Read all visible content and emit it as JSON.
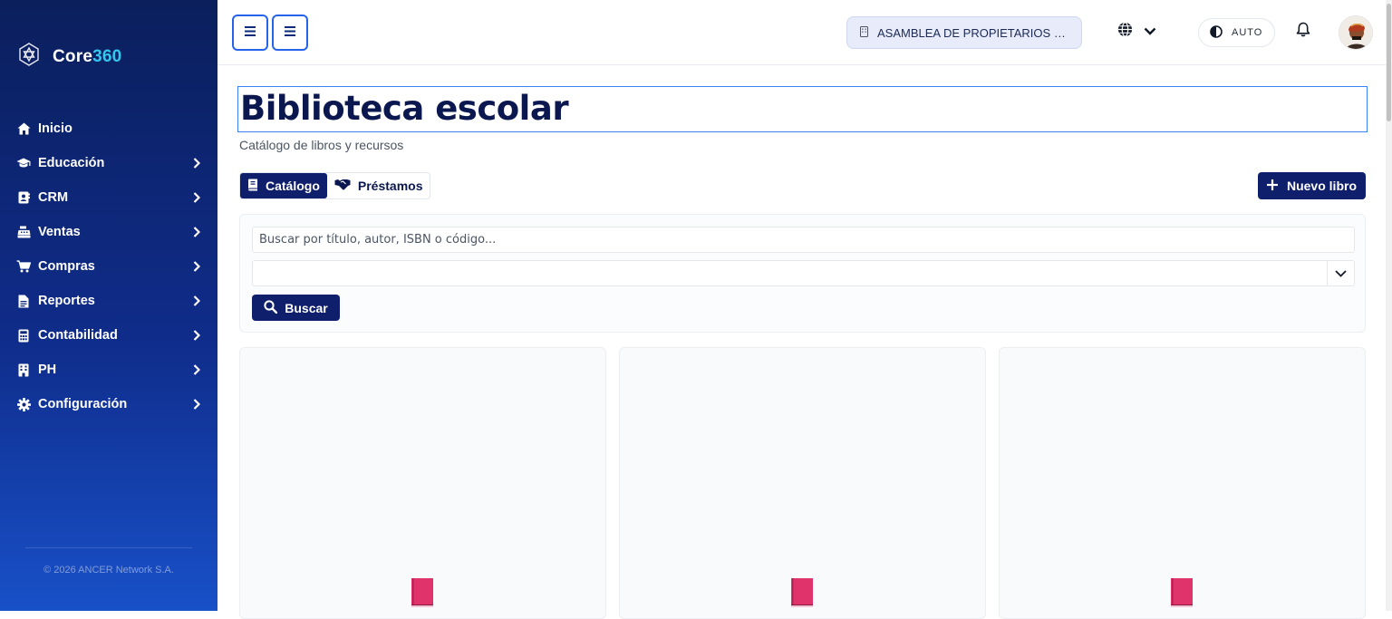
{
  "app": {
    "logo_prefix": "Core",
    "logo_suffix": "360",
    "footer": "© 2026 ANCER Network S.A."
  },
  "sidebar": {
    "items": [
      {
        "label": "Inicio",
        "icon": "home-icon",
        "has_children": false
      },
      {
        "label": "Educación",
        "icon": "graduation-cap-icon",
        "has_children": true
      },
      {
        "label": "CRM",
        "icon": "contact-book-icon",
        "has_children": true
      },
      {
        "label": "Ventas",
        "icon": "cash-register-icon",
        "has_children": true
      },
      {
        "label": "Compras",
        "icon": "shopping-cart-icon",
        "has_children": true
      },
      {
        "label": "Reportes",
        "icon": "file-report-icon",
        "has_children": true
      },
      {
        "label": "Contabilidad",
        "icon": "calculator-icon",
        "has_children": true
      },
      {
        "label": "PH",
        "icon": "building-icon",
        "has_children": true
      },
      {
        "label": "Configuración",
        "icon": "gear-icon",
        "has_children": true
      }
    ]
  },
  "topbar": {
    "organization": "ASAMBLEA DE PROPIETARIOS DE ...",
    "theme_mode": "AUTO"
  },
  "page": {
    "title": "Biblioteca escolar",
    "subtitle": "Catálogo de libros y recursos",
    "tabs": [
      {
        "label": "Catálogo",
        "active": true,
        "icon": "book-icon"
      },
      {
        "label": "Préstamos",
        "active": false,
        "icon": "handshake-icon"
      }
    ],
    "new_button": "Nuevo libro",
    "search": {
      "placeholder": "Buscar por título, autor, ISBN o código...",
      "value": ""
    },
    "filter_select": {
      "value": ""
    },
    "search_button": "Buscar",
    "book_cards": 3
  },
  "colors": {
    "primary": "#0f1f6b",
    "accent": "#33c6ee",
    "book_icon": "#e0336b",
    "focus_border": "#3b82f6"
  }
}
